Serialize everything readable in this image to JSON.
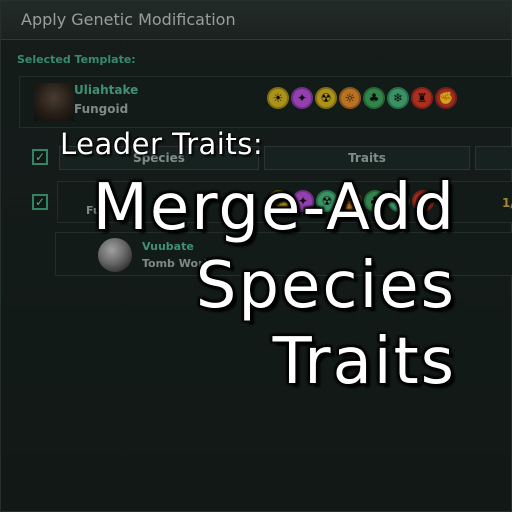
{
  "window": {
    "title": "Apply Genetic Modification"
  },
  "template": {
    "section_label": "Selected Template:",
    "name": "Uliahtake",
    "species_type": "Fungoid",
    "trait_colors": [
      "#d3b21f",
      "#b34fd6",
      "#d3b21f",
      "#e28a2d",
      "#3ea35a",
      "#45b37a",
      "#d03a26",
      "#c0352b"
    ],
    "trait_icons": [
      "dna-icon",
      "star-icon",
      "radiation-icon",
      "sun-icon",
      "branch-icon",
      "snowflake-icon",
      "crest-icon",
      "fist-icon"
    ]
  },
  "table": {
    "headers": [
      "Species",
      "Traits",
      ""
    ],
    "rows": [
      {
        "checked": true,
        "name": "",
        "species_type": "Fu",
        "counter": "1/"
      },
      {
        "checked": true,
        "name": "Vuubate",
        "species_type": "Tomb World"
      }
    ],
    "select_all_checked": true
  },
  "overlay": {
    "small_text": "Leader Traits:",
    "big_lines": [
      "Merge-Add",
      "Species",
      "Traits"
    ]
  }
}
